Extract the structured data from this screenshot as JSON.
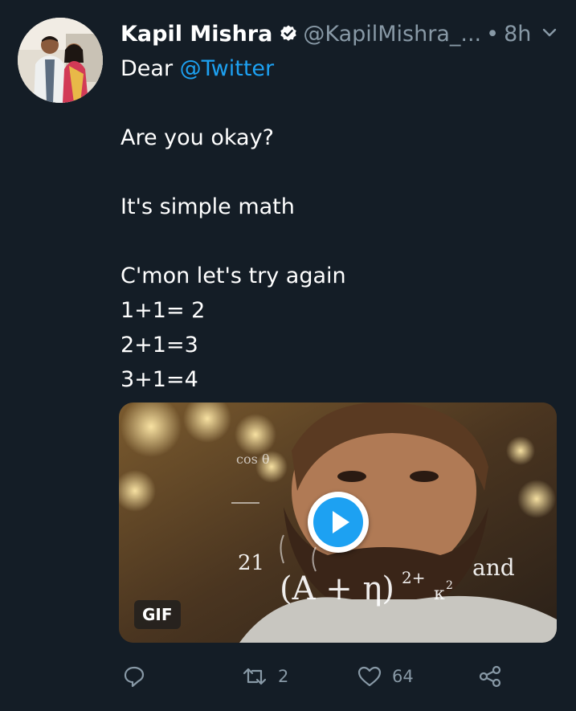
{
  "tweet": {
    "author_name": "Kapil Mishra",
    "author_handle": "@KapilMishra_...",
    "separator": "•",
    "timestamp": "8h",
    "verified": true,
    "lines": [
      {
        "prefix": "Dear ",
        "mention": "@Twitter"
      },
      {
        "text": ""
      },
      {
        "text": "Are you okay?"
      },
      {
        "text": ""
      },
      {
        "text": "It's simple math"
      },
      {
        "text": ""
      },
      {
        "text": "C'mon let's try again"
      },
      {
        "text": "1+1= 2"
      },
      {
        "text": "2+1=3"
      },
      {
        "text": "3+1=4"
      }
    ],
    "media": {
      "type": "gif",
      "badge": "GIF",
      "overlay_texts": [
        "21",
        "(A + η)",
        "2+",
        "κ",
        "2",
        "and",
        "cos θ"
      ]
    },
    "actions": {
      "reply_icon": "reply-icon",
      "retweet_icon": "retweet-icon",
      "retweet_count": "2",
      "like_icon": "heart-icon",
      "like_count": "64",
      "share_icon": "share-icon"
    },
    "colors": {
      "background": "#141d26",
      "accent": "#1da1f2",
      "muted": "#8899a6"
    }
  }
}
